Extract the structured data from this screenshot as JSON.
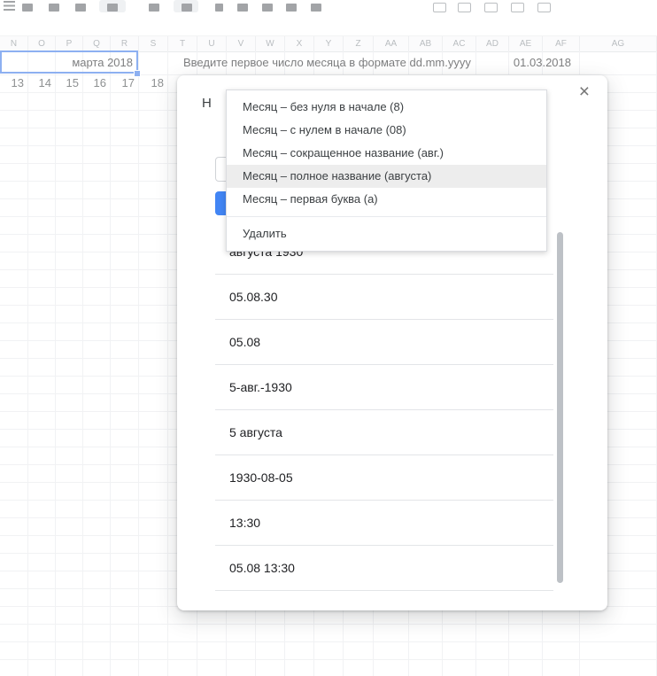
{
  "colors": {
    "accent_blue": "#4285f4",
    "menu_highlight": "#ededed",
    "scrollbar": "#bdc1c6",
    "selection_blue": "#3b78e7"
  },
  "sheet": {
    "columns": [
      "N",
      "O",
      "P",
      "Q",
      "R",
      "S",
      "T",
      "U",
      "V",
      "W",
      "X",
      "Y",
      "Z",
      "AA",
      "AB",
      "AC",
      "AD",
      "AE",
      "AF",
      "AG"
    ],
    "row2_values": [
      "13",
      "14",
      "15",
      "16",
      "17",
      "18"
    ],
    "selected_cell_text": "марта 2018",
    "hint_text": "Введите первое число месяца в формате dd.mm.yyyy",
    "date_value": "01.03.2018"
  },
  "dialog": {
    "title_visible": "Н",
    "close_icon": "×",
    "examples": [
      "августа 1930",
      "05.08.30",
      "05.08",
      "5-авг.-1930",
      "5 августа",
      "1930-08-05",
      "13:30",
      "05.08 13:30"
    ]
  },
  "menu": {
    "items": [
      "Месяц – без нуля в начале (8)",
      "Месяц – с нулем в начале (08)",
      "Месяц – сокращенное название (авг.)",
      "Месяц – полное название (августа)",
      "Месяц – первая буква (а)"
    ],
    "highlighted_index": 3,
    "delete_item": "Удалить"
  }
}
